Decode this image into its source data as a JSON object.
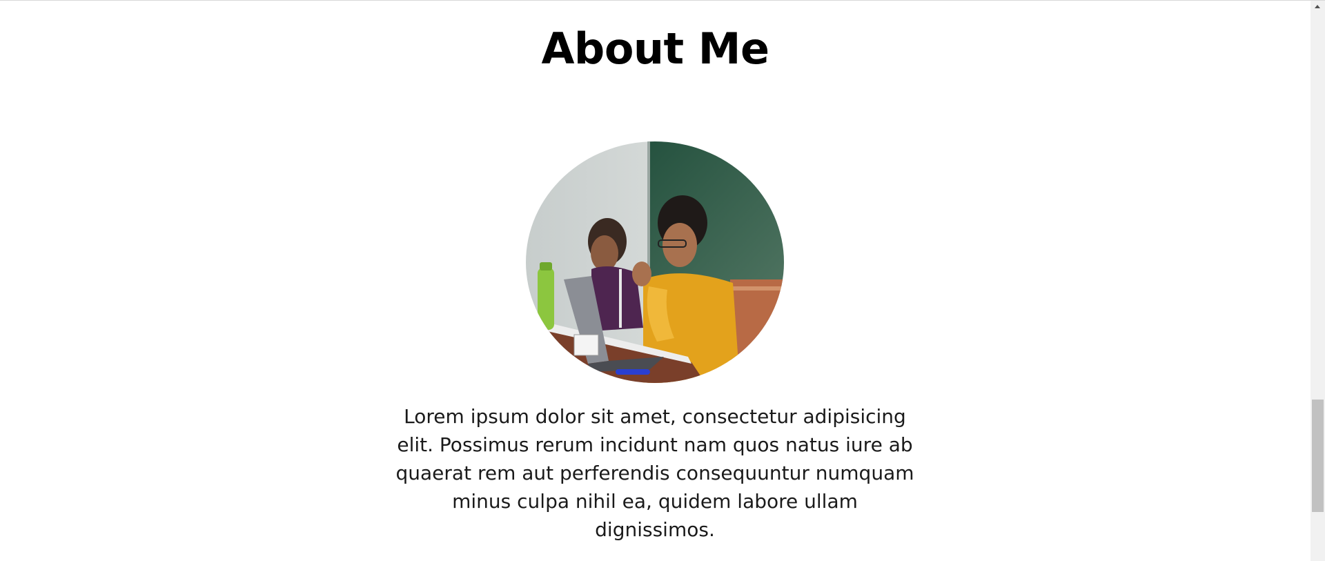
{
  "about": {
    "title": "About Me",
    "photo_icon": "profile-photo",
    "bio": "Lorem ipsum dolor sit amet, consectetur adipisicing elit. Possimus rerum incidunt nam quos natus iure ab quaerat rem aut perferendis consequuntur numquam minus culpa nihil ea, quidem labore ullam dignissimos."
  },
  "scrollbar": {
    "up_icon": "arrow-up-icon",
    "position_fraction": 0.71
  }
}
